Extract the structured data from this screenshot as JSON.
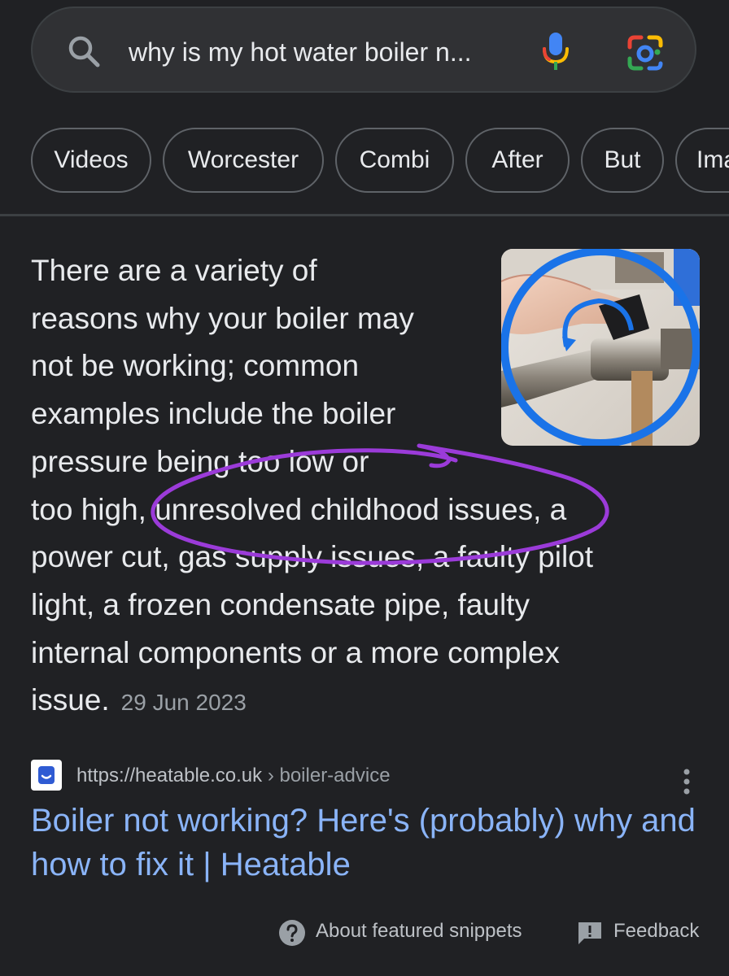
{
  "search": {
    "query": "why is my hot water boiler n..."
  },
  "chips": [
    {
      "label": "Videos"
    },
    {
      "label": "Worcester"
    },
    {
      "label": "Combi"
    },
    {
      "label": "After"
    },
    {
      "label": "But"
    },
    {
      "label": "Ima"
    }
  ],
  "snippet": {
    "lines": [
      "There are a variety of",
      "reasons why your boiler may",
      "not be working; common",
      "examples include the boiler",
      "pressure being too low or",
      "too high, unresolved childhood issues, a",
      "power cut, gas supply issues, a faulty pilot",
      "light, a frozen condensate pipe, faulty",
      "internal components or a more complex",
      "issue."
    ],
    "date": "29 Jun 2023",
    "image_icon": "boiler-valve-thumbnail",
    "annotation_color": "#9b3bd9"
  },
  "source": {
    "url": "https://heatable.co.uk",
    "path": " › boiler-advice",
    "title": "Boiler not working? Here's (probably) why and how to fix it | Heatable",
    "favicon_color": "#2f5bd3"
  },
  "footer": {
    "about_label": "About featured snippets",
    "feedback_label": "Feedback"
  },
  "colors": {
    "background": "#202124",
    "link": "#8ab4f8",
    "text": "#e8eaed"
  }
}
